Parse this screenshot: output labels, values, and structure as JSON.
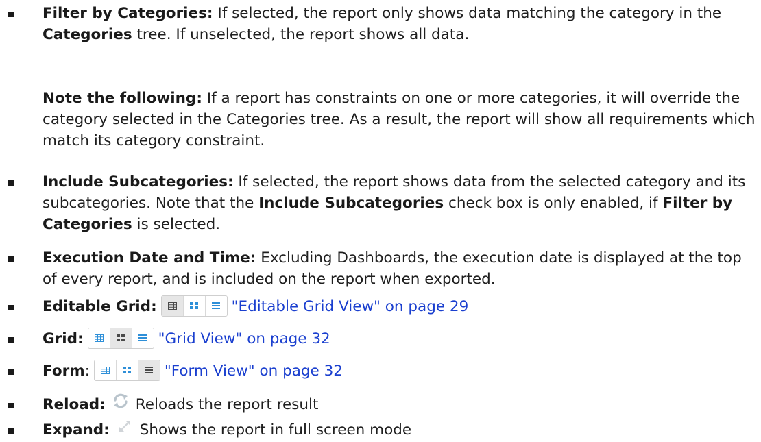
{
  "items": {
    "filter": {
      "label": "Filter by Categories:",
      "t1": " If selected, the report only shows data matching the category in the ",
      "b1": "Categories",
      "t2": " tree. If unselected, the report shows all data."
    },
    "note": {
      "label": "Note the following:",
      "text": " If a report has constraints on one or more categories, it will override the category selected in the Categories tree. As a result, the report will show all requirements which match its category constraint."
    },
    "subcat": {
      "label": "Include Subcategories:",
      "t1": " If selected, the report shows data from the selected category and its subcategories. Note that the ",
      "b1": "Include Subcategories",
      "t2": " check box is only enabled, if ",
      "b2": "Filter by Categories",
      "t3": " is selected."
    },
    "exec": {
      "label": "Execution Date and Time:",
      "text": " Excluding Dashboards, the execution date is displayed at the top of every report, and is included on the report when exported."
    },
    "editable_grid": {
      "label": "Editable Grid:",
      "link": "\"Editable Grid View\" on page 29",
      "active_view": "editable-grid"
    },
    "grid": {
      "label": "Grid:",
      "link": "\"Grid View\" on page 32",
      "active_view": "grid"
    },
    "form": {
      "label": "Form",
      "colon": ":",
      "link": "\"Form View\" on page 32",
      "active_view": "form"
    },
    "reload": {
      "label": "Reload:",
      "text": "Reloads the report result",
      "icon": "reload-icon"
    },
    "expand": {
      "label": "Expand:",
      "text": "Shows the report in full screen mode",
      "icon": "expand-icon"
    }
  },
  "colors": {
    "link": "#1a3fcf",
    "icon_blue": "#2e8fd8",
    "icon_gray": "#4a4a4a"
  }
}
